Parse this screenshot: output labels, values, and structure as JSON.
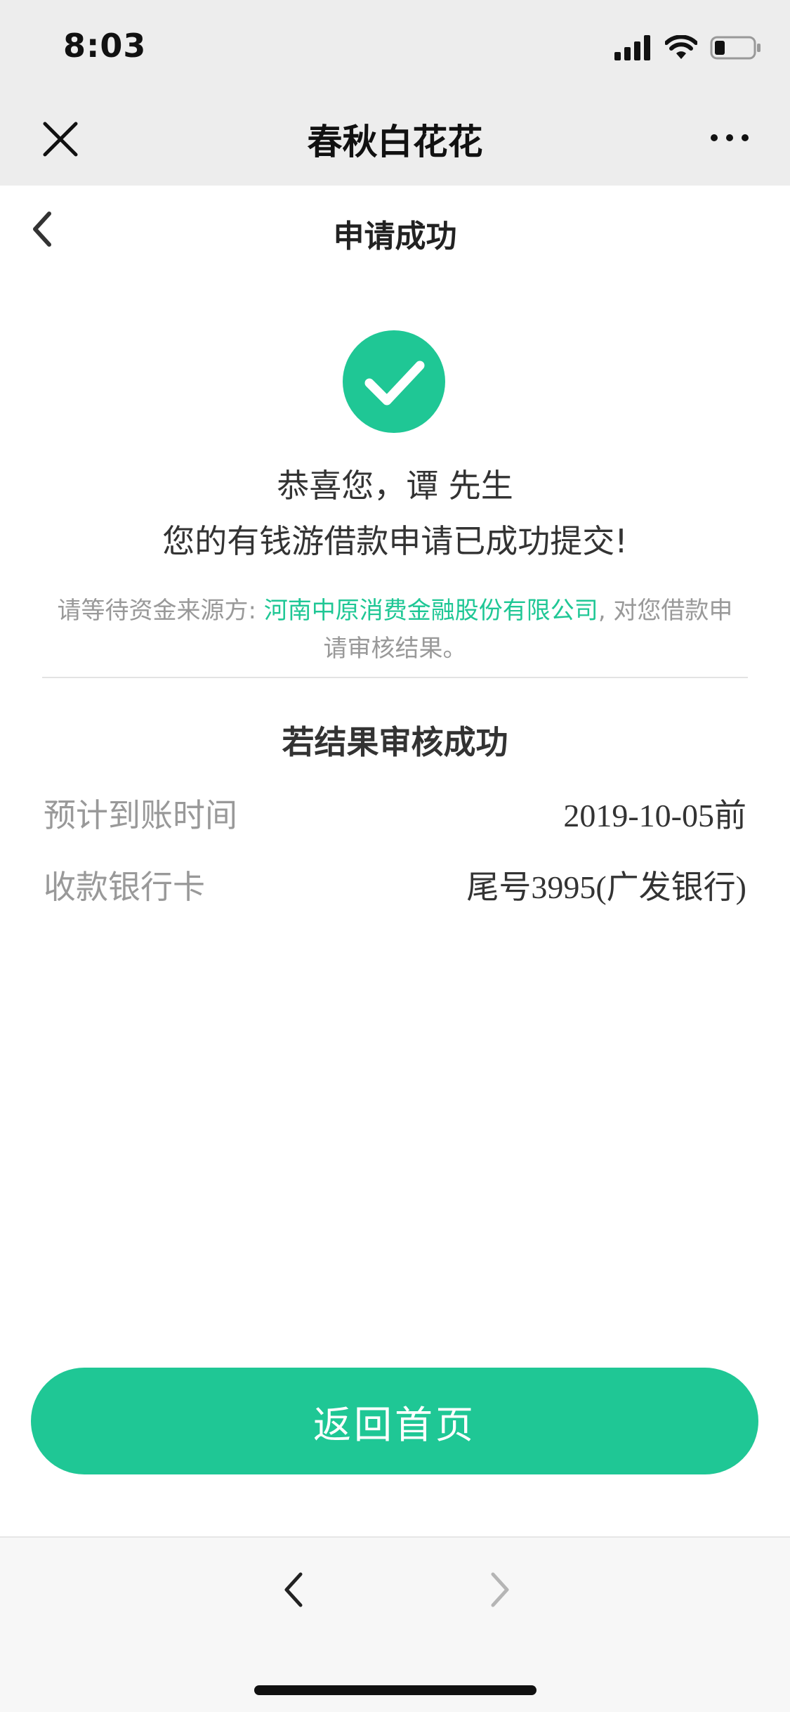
{
  "status_bar": {
    "time": "8:03"
  },
  "nav": {
    "title": "春秋白花花"
  },
  "page": {
    "title": "申请成功"
  },
  "success": {
    "line1": "恭喜您，谭 先生",
    "line2": "您的有钱游借款申请已成功提交!",
    "notice_prefix": "请等待资金来源方: ",
    "notice_company": "河南中原消费金融股份有限公司",
    "notice_suffix": ", 对您借款申请审核结果。"
  },
  "result": {
    "title": "若结果审核成功",
    "rows": [
      {
        "label": "预计到账时间",
        "value": "2019-10-05前"
      },
      {
        "label": "收款银行卡",
        "value": "尾号3995(广发银行)"
      }
    ]
  },
  "actions": {
    "home_button": "返回首页"
  },
  "colors": {
    "accent": "#1fc795",
    "muted_text": "#999999",
    "nav_bg": "#ededed"
  }
}
